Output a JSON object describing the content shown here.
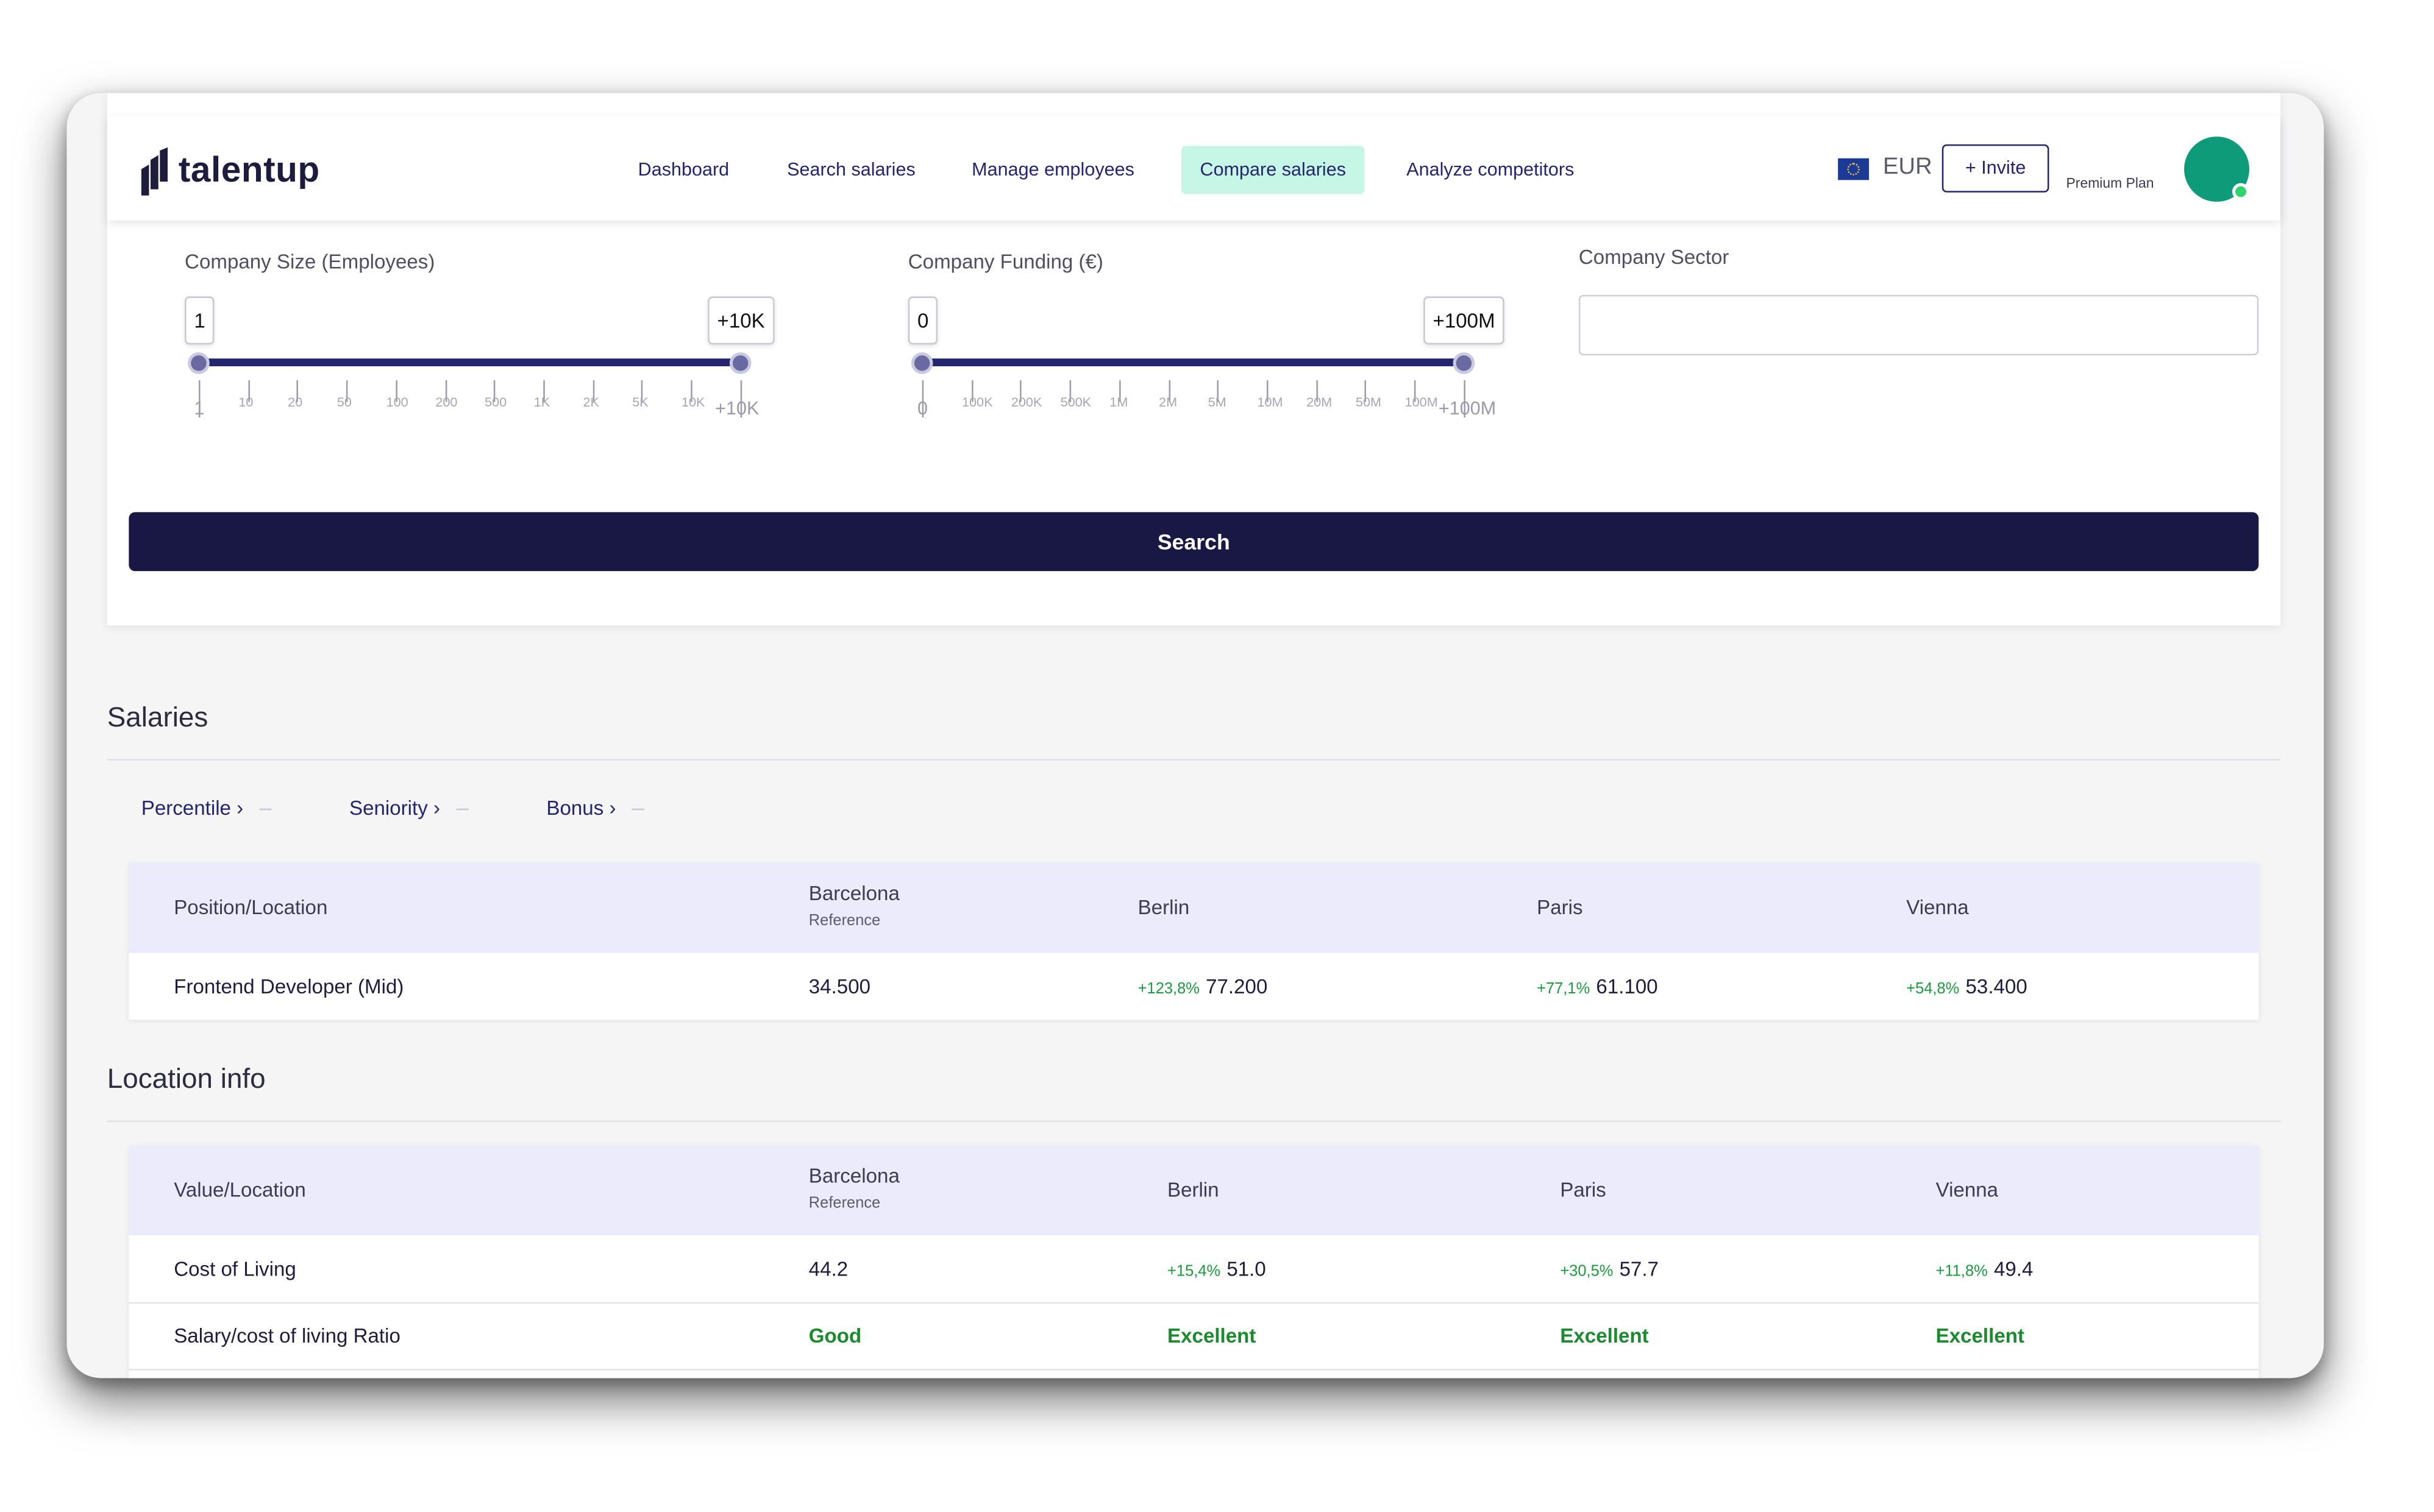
{
  "header": {
    "logo_text": "talentup",
    "nav": [
      "Dashboard",
      "Search salaries",
      "Manage employees",
      "Compare salaries",
      "Analyze competitors"
    ],
    "active_nav": "Compare salaries",
    "currency": "EUR",
    "invite_label": "+ Invite",
    "plan_label": "Premium Plan",
    "colors": {
      "accent": "#c5f6e6",
      "brand_dark": "#191744",
      "positive": "#1c9b3e"
    }
  },
  "filters": {
    "company_size": {
      "label": "Company Size (Employees)",
      "min_value": "1",
      "max_value": "+10K",
      "ticks": [
        "1",
        "10",
        "20",
        "50",
        "100",
        "200",
        "500",
        "1K",
        "2K",
        "5K",
        "10K",
        "+10K"
      ]
    },
    "company_funding": {
      "label": "Company Funding (€)",
      "min_value": "0",
      "max_value": "+100M",
      "ticks": [
        "0",
        "100K",
        "200K",
        "500K",
        "1M",
        "2M",
        "5M",
        "10M",
        "20M",
        "50M",
        "100M",
        "+100M"
      ]
    },
    "company_sector": {
      "label": "Company Sector",
      "value": ""
    },
    "search_label": "Search"
  },
  "salaries": {
    "title": "Salaries",
    "tabs": [
      "Percentile ›",
      "Seniority ›",
      "Bonus ›"
    ],
    "header_first": "Position/Location",
    "reference_label": "Reference",
    "columns": [
      "Barcelona",
      "Berlin",
      "Paris",
      "Vienna"
    ],
    "rows": [
      {
        "label": "Frontend Developer (Mid)",
        "values": [
          "34.500",
          "77.200",
          "61.100",
          "53.400"
        ],
        "deltas": [
          "",
          "+123,8%",
          "+77,1%",
          "+54,8%"
        ]
      }
    ]
  },
  "location_info": {
    "title": "Location info",
    "header_first": "Value/Location",
    "reference_label": "Reference",
    "columns": [
      "Barcelona",
      "Berlin",
      "Paris",
      "Vienna"
    ],
    "rows": [
      {
        "label": "Cost of Living",
        "values": [
          "44.2",
          "51.0",
          "57.7",
          "49.4"
        ],
        "deltas": [
          "",
          "+15,4%",
          "+30,5%",
          "+11,8%"
        ]
      },
      {
        "label": "Salary/cost of living Ratio",
        "values": [
          "Good",
          "Excellent",
          "Excellent",
          "Excellent"
        ]
      }
    ]
  }
}
